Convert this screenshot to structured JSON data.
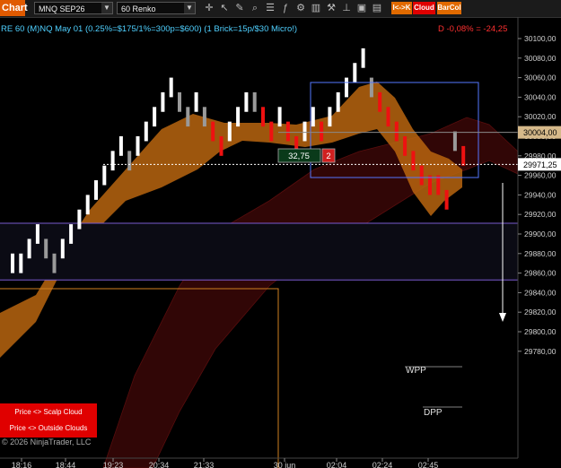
{
  "toolbar": {
    "app_tab": "Chart",
    "instrument": "MNQ SEP26",
    "bar_type": "60 Renko",
    "icons": [
      "crosshair-icon",
      "pointer-icon",
      "draw-icon",
      "zoom-icon",
      "properties-icon",
      "indicators-icon",
      "strategies-icon",
      "bar-chart-icon",
      "hammer-icon",
      "stamp-icon",
      "data-box-icon",
      "templates-icon"
    ],
    "pill_arrow": "I<->K",
    "pill_cloud": "Cloud",
    "pill_barcol": "BarCol"
  },
  "header": {
    "series_desc": "RE 60 (M)NQ May 01 (0.25%=$175/1%=300p=$600) (1 Brick=15p/$30 Micro!)",
    "change": "D -0,08% = -24,25"
  },
  "price_axis": {
    "ticks": [
      "30100,00",
      "30080,00",
      "30060,00",
      "30040,00",
      "30020,00",
      "30000,00",
      "29980,00",
      "29960,00",
      "29940,00",
      "29920,00",
      "29900,00",
      "29880,00",
      "29860,00",
      "29840,00",
      "29820,00",
      "29800,00",
      "29780,00"
    ],
    "marker_upper": "30004,00",
    "marker_last": "29971,25"
  },
  "time_axis": {
    "ticks": [
      "18:16",
      "18:44",
      "19:23",
      "20:34",
      "21:33",
      "30 jun",
      "02:04",
      "02:24",
      "02:45"
    ]
  },
  "overlays": {
    "measure_value": "32,75",
    "measure_count": "2",
    "wpp_label": "WPP",
    "dpp_label": "DPP"
  },
  "panel": {
    "scalp_cloud_button": "Price <> Scalp Cloud",
    "outside_clouds_button": "Price <> Outside Clouds",
    "copyright": "© 2026 NinjaTrader, LLC"
  },
  "colors": {
    "bull_brick": "#ffffff",
    "bear_brick": "#ee1111",
    "gray_brick": "#9a9a9a",
    "scalp_cloud": "#b8650f",
    "outer_cloud": "#5a0c0c",
    "band_lines": "#7a5bd0",
    "measure_box": "#5577ff"
  },
  "chart_data": {
    "type": "candlestick",
    "title": "",
    "instrument": "MNQ SEP26",
    "bar_type": "60 Renko",
    "y_axis_range": [
      29770,
      30110
    ],
    "brick_size_points": 15,
    "last_price": 29971.25,
    "price_line_upper": 30004.0,
    "bricks": [
      {
        "dir": "up",
        "low": 29860,
        "high": 29880
      },
      {
        "dir": "up",
        "low": 29860,
        "high": 29880
      },
      {
        "dir": "up",
        "low": 29875,
        "high": 29895
      },
      {
        "dir": "up",
        "low": 29890,
        "high": 29910
      },
      {
        "dir": "gray",
        "low": 29875,
        "high": 29895
      },
      {
        "dir": "gray",
        "low": 29860,
        "high": 29880
      },
      {
        "dir": "up",
        "low": 29875,
        "high": 29895
      },
      {
        "dir": "up",
        "low": 29890,
        "high": 29910
      },
      {
        "dir": "up",
        "low": 29905,
        "high": 29925
      },
      {
        "dir": "up",
        "low": 29920,
        "high": 29940
      },
      {
        "dir": "up",
        "low": 29935,
        "high": 29955
      },
      {
        "dir": "up",
        "low": 29950,
        "high": 29970
      },
      {
        "dir": "up",
        "low": 29965,
        "high": 29985
      },
      {
        "dir": "up",
        "low": 29980,
        "high": 30000
      },
      {
        "dir": "gray",
        "low": 29965,
        "high": 29985
      },
      {
        "dir": "up",
        "low": 29980,
        "high": 30000
      },
      {
        "dir": "up",
        "low": 29995,
        "high": 30015
      },
      {
        "dir": "up",
        "low": 30010,
        "high": 30030
      },
      {
        "dir": "up",
        "low": 30025,
        "high": 30045
      },
      {
        "dir": "up",
        "low": 30040,
        "high": 30060
      },
      {
        "dir": "gray",
        "low": 30025,
        "high": 30045
      },
      {
        "dir": "gray",
        "low": 30010,
        "high": 30030
      },
      {
        "dir": "up",
        "low": 30025,
        "high": 30045
      },
      {
        "dir": "gray",
        "low": 30010,
        "high": 30030
      },
      {
        "dir": "down",
        "low": 29995,
        "high": 30015
      },
      {
        "dir": "down",
        "low": 29980,
        "high": 30000
      },
      {
        "dir": "up",
        "low": 29995,
        "high": 30015
      },
      {
        "dir": "up",
        "low": 30010,
        "high": 30030
      },
      {
        "dir": "up",
        "low": 30025,
        "high": 30045
      },
      {
        "dir": "gray",
        "low": 30025,
        "high": 30045
      },
      {
        "dir": "down",
        "low": 30010,
        "high": 30030
      },
      {
        "dir": "down",
        "low": 29995,
        "high": 30015
      },
      {
        "dir": "up",
        "low": 30010,
        "high": 30030
      },
      {
        "dir": "down",
        "low": 29995,
        "high": 30015
      },
      {
        "dir": "down",
        "low": 29980,
        "high": 30000
      },
      {
        "dir": "up",
        "low": 29995,
        "high": 30015
      },
      {
        "dir": "up",
        "low": 30010,
        "high": 30030
      },
      {
        "dir": "down",
        "low": 29995,
        "high": 30015
      },
      {
        "dir": "up",
        "low": 30010,
        "high": 30030
      },
      {
        "dir": "up",
        "low": 30025,
        "high": 30045
      },
      {
        "dir": "up",
        "low": 30040,
        "high": 30060
      },
      {
        "dir": "up",
        "low": 30055,
        "high": 30075
      },
      {
        "dir": "up",
        "low": 30070,
        "high": 30090
      },
      {
        "dir": "gray",
        "low": 30040,
        "high": 30060
      },
      {
        "dir": "down",
        "low": 30025,
        "high": 30045
      },
      {
        "dir": "down",
        "low": 30010,
        "high": 30030
      },
      {
        "dir": "down",
        "low": 29995,
        "high": 30015
      },
      {
        "dir": "down",
        "low": 29980,
        "high": 30000
      },
      {
        "dir": "down",
        "low": 29965,
        "high": 29985
      },
      {
        "dir": "down",
        "low": 29950,
        "high": 29970
      },
      {
        "dir": "down",
        "low": 29940,
        "high": 29960
      },
      {
        "dir": "down",
        "low": 29940,
        "high": 29960
      },
      {
        "dir": "down",
        "low": 29925,
        "high": 29945
      },
      {
        "dir": "gray",
        "low": 29985,
        "high": 30005
      },
      {
        "dir": "down",
        "low": 29970,
        "high": 29990
      }
    ],
    "horizontal_levels": [
      {
        "name": "upper-band",
        "value": 29911
      },
      {
        "name": "lower-band",
        "value": 29853
      },
      {
        "name": "orange-box-top",
        "value": 29844
      }
    ]
  }
}
